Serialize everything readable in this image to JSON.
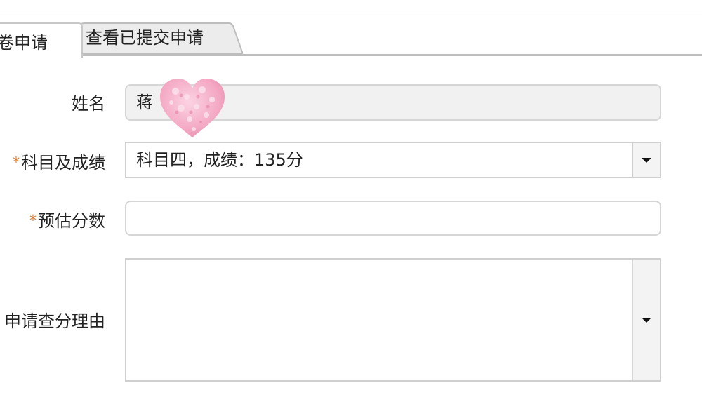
{
  "tabs": [
    {
      "label": "卷申请",
      "active": true
    },
    {
      "label": "查看已提交申请",
      "active": false
    }
  ],
  "form": {
    "name": {
      "label": "姓名",
      "value": "蒋"
    },
    "subject": {
      "required_mark": "*",
      "label": "科目及成绩",
      "value": "科目四，成绩：135分"
    },
    "estimate": {
      "required_mark": "*",
      "label": "预估分数",
      "value": ""
    },
    "reason": {
      "label": "申请查分理由",
      "value": ""
    }
  },
  "colors": {
    "required": "#e07b2a",
    "heart_sticker": "#f4a9c4"
  }
}
